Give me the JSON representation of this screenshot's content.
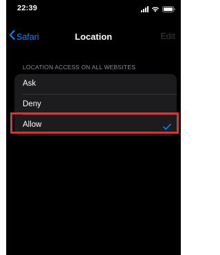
{
  "status_bar": {
    "time": "22:39"
  },
  "nav": {
    "back_label": "Safari",
    "title": "Location",
    "edit_label": "Edit"
  },
  "section": {
    "header": "LOCATION ACCESS ON ALL WEBSITES",
    "options": [
      {
        "label": "Ask",
        "selected": false
      },
      {
        "label": "Deny",
        "selected": false
      },
      {
        "label": "Allow",
        "selected": true
      }
    ]
  },
  "colors": {
    "accent": "#0a84ff",
    "background": "#000000",
    "group_background": "#1c1c1e",
    "highlight": "#e03030"
  },
  "icons": {
    "back": "chevron-left-icon",
    "selected": "checkmark-icon",
    "cellular": "signal-icon",
    "wifi": "wifi-icon",
    "battery": "battery-icon"
  }
}
